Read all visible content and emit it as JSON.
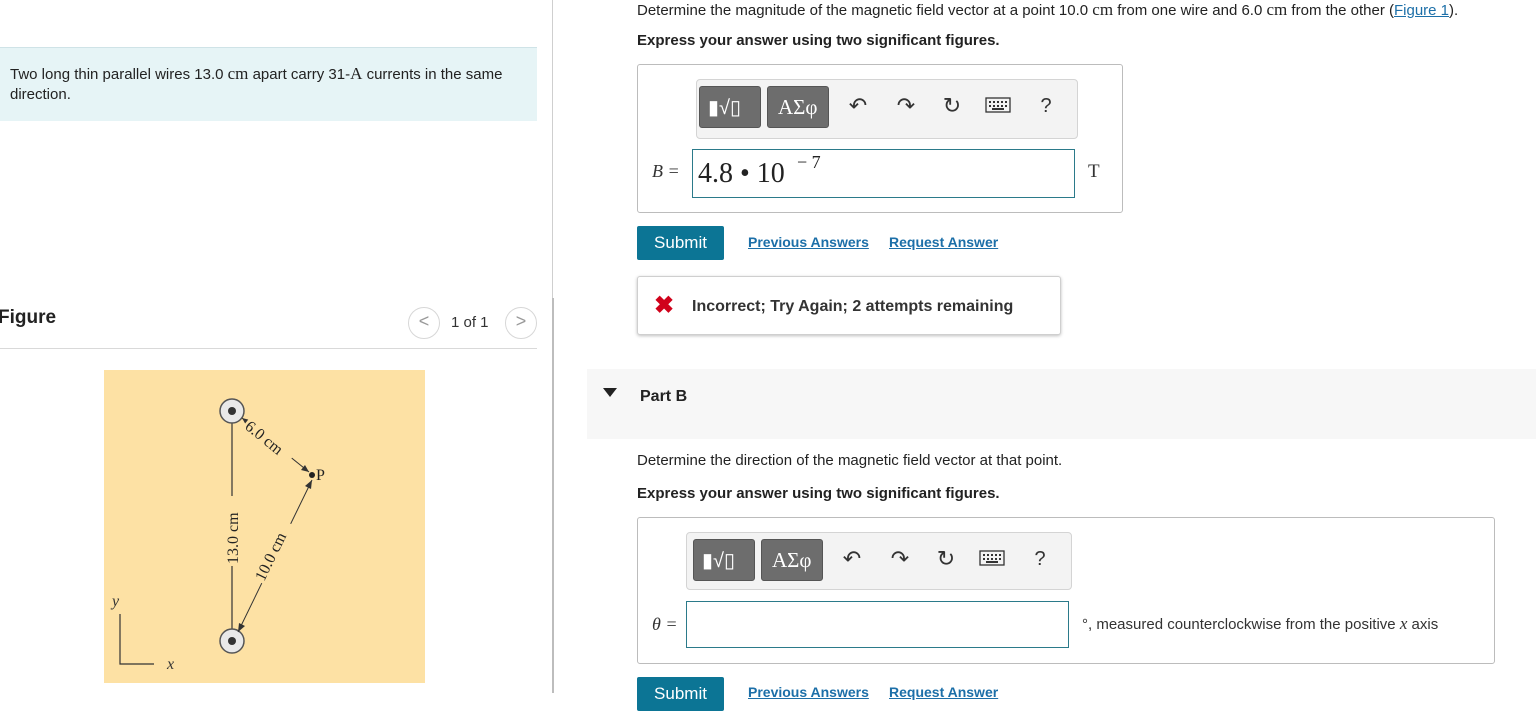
{
  "problem": {
    "text_before_1": "Two long thin parallel wires 13.0 ",
    "unit_cm": "cm",
    "text_middle": " apart carry 31-",
    "unit_A": "A",
    "text_after": " currents in the same direction."
  },
  "figure": {
    "title": "Figure",
    "pager": {
      "label": "1 of 1",
      "prev": "<",
      "next": ">"
    },
    "labels": {
      "d1": "6.0 cm",
      "d2": "10.0 cm",
      "sep": "13.0 cm",
      "point": "P",
      "y": "y",
      "x": "x"
    }
  },
  "partA": {
    "question_prefix": "Determine the magnitude of the magnetic field vector at a point 10.0 ",
    "unit1": "cm",
    "question_mid": " from one wire and 6.0 ",
    "unit2": "cm",
    "question_suffix": " from the other (",
    "figure_link": "Figure 1",
    "question_end": ").",
    "instruction": "Express your answer using two significant figures.",
    "toolbar": {
      "templates": "▮√▯",
      "greek": "ΑΣφ",
      "help": "?"
    },
    "label": "B =",
    "answer_value": "4.8 • 10",
    "answer_exp": "− 7",
    "unit": "T",
    "submit": "Submit",
    "previous_answers": "Previous Answers",
    "request_answer": "Request Answer",
    "feedback": "Incorrect; Try Again; 2 attempts remaining"
  },
  "partB": {
    "title": "Part B",
    "question": "Determine the direction of the magnetic field vector at that point.",
    "instruction": "Express your answer using two significant figures.",
    "toolbar": {
      "templates": "▮√▯",
      "greek": "ΑΣφ",
      "help": "?"
    },
    "label": "θ =",
    "answer_value": "",
    "unit_suffix": "°, measured counterclockwise from the positive ",
    "axis_var": "x",
    "axis_word": " axis",
    "submit": "Submit",
    "previous_answers": "Previous Answers",
    "request_answer": "Request Answer"
  },
  "colors": {
    "accent": "#0c7595",
    "link": "#1c6fa8",
    "error": "#d0021b",
    "figure_bg": "#fde1a4",
    "problem_bg": "#e6f4f6"
  }
}
